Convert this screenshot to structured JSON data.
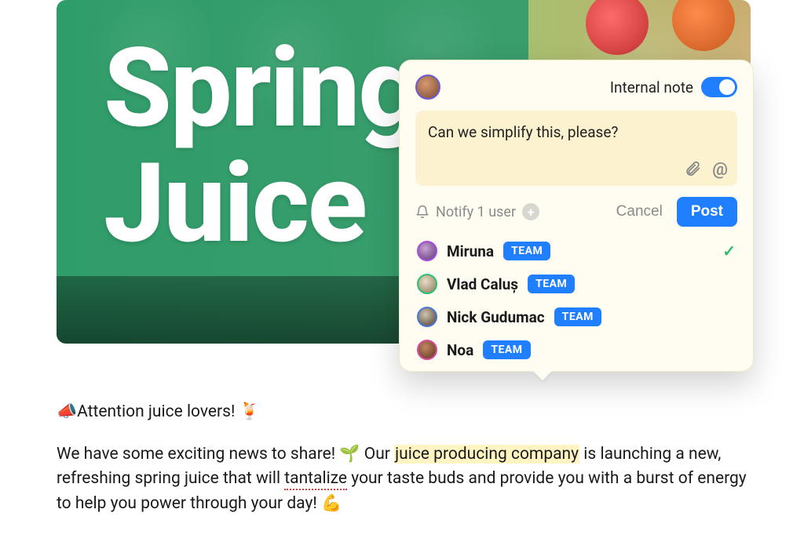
{
  "hero": {
    "title_line1": "Spring",
    "title_line2": "Juice"
  },
  "post": {
    "line1_prefix": "📣Attention juice lovers! ",
    "line1_emoji": "🍹",
    "line2_part1": "We have some exciting news to share! 🌱 Our ",
    "line2_highlight": "juice producing company",
    "line2_part2": " is launching a new, refreshing spring juice that will ",
    "line2_spellcheck": "tantalize",
    "line2_part3": " your taste buds and provide you with a burst of energy to help you power through your day! 💪"
  },
  "popover": {
    "internal_label": "Internal note",
    "internal_on": true,
    "note_text": "Can we simplify this, please?",
    "notify_label": "Notify 1 user",
    "cancel_label": "Cancel",
    "post_label": "Post",
    "badge_label": "TEAM",
    "users": [
      {
        "name": "Miruna",
        "avatar_class": "av-miruna",
        "selected": true
      },
      {
        "name": "Vlad Caluș",
        "avatar_class": "av-vlad",
        "selected": false
      },
      {
        "name": "Nick Gudumac",
        "avatar_class": "av-nick",
        "selected": false
      },
      {
        "name": "Noa",
        "avatar_class": "av-noa",
        "selected": false
      }
    ]
  }
}
